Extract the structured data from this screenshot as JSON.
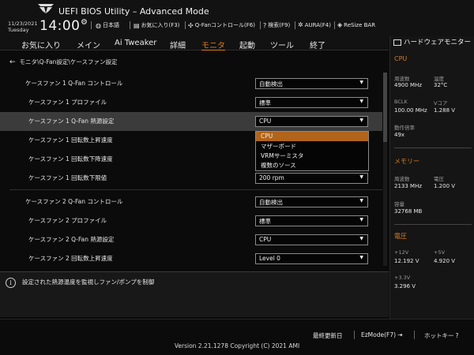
{
  "header": {
    "title": "UEFI BIOS Utility – Advanced Mode",
    "date": "11/23/2021",
    "weekday": "Tuesday",
    "time": "14:00",
    "toolbar": [
      {
        "icon": "globe-icon",
        "label": "日本語"
      },
      {
        "icon": "favorite-icon",
        "label": "お気に入り(F3)"
      },
      {
        "icon": "fan-icon",
        "label": "Q-Fanコントロール(F6)"
      },
      {
        "icon": "help-search-icon",
        "label": "検索(F9)"
      },
      {
        "icon": "aura-icon",
        "label": "AURA(F4)"
      },
      {
        "icon": "resize-bar-icon",
        "label": "ReSize BAR"
      }
    ]
  },
  "menu": {
    "items": [
      "お気に入り",
      "メイン",
      "Ai Tweaker",
      "詳細",
      "モニタ",
      "起動",
      "ツール",
      "終了"
    ],
    "active": "モニタ",
    "accent_color": "#d87a1c"
  },
  "breadcrumb": {
    "text": "モニタ\\Q-Fan設定\\ケースファン設定"
  },
  "settings": [
    {
      "label": "ケースファン 1 Q-Fan コントロール",
      "value": "自動検出"
    },
    {
      "label": "ケースファン 1 プロファイル",
      "value": "標準"
    },
    {
      "label": "ケースファン 1 Q-Fan 熱源設定",
      "value": "CPU"
    },
    {
      "label": "ケースファン 1 回転数上昇速度",
      "value": ""
    },
    {
      "label": "ケースファン 1 回転数下降速度",
      "value": ""
    },
    {
      "label": "ケースファン 1 回転数下限値",
      "value": "200 rpm"
    },
    {
      "label": "ケースファン 2 Q-Fan コントロール",
      "value": "自動検出"
    },
    {
      "label": "ケースファン 2 プロファイル",
      "value": "標準"
    },
    {
      "label": "ケースファン 2 Q-Fan 熱源設定",
      "value": "CPU"
    },
    {
      "label": "ケースファン 2 回転数上昇速度",
      "value": "Level 0"
    }
  ],
  "dropdown": {
    "options": [
      "CPU",
      "マザーボード",
      "VRMサーミスタ",
      "複数のソース"
    ],
    "selected": "CPU"
  },
  "help": {
    "text": "設定された熱源温度を監視しファン/ポンプを制御"
  },
  "hardware_monitor": {
    "title": "ハードウェアモニター",
    "cpu": {
      "section": "CPU",
      "frequency_label": "周波数",
      "frequency": "4900 MHz",
      "temperature_label": "温度",
      "temperature": "32°C",
      "bclk_label": "BCLK",
      "bclk": "100.00 MHz",
      "vcore_label": "Vコア",
      "vcore": "1.288 V",
      "ratio_label": "動作倍率",
      "ratio": "49x"
    },
    "memory": {
      "section": "メモリー",
      "frequency_label": "周波数",
      "frequency": "2133 MHz",
      "voltage_label": "電圧",
      "voltage": "1.200 V",
      "capacity_label": "容量",
      "capacity": "32768 MB"
    },
    "voltage": {
      "section": "電圧",
      "v12_label": "+12V",
      "v12": "12.192 V",
      "v5_label": "+5V",
      "v5": "4.920 V",
      "v33_label": "+3.3V",
      "v33": "3.296 V"
    }
  },
  "footer": {
    "last_modified": "最終更新日",
    "ezmode": "EzMode(F7)",
    "hotkeys": "ホットキー",
    "copyright": "Version 2.21.1278 Copyright (C) 2021 AMI"
  }
}
